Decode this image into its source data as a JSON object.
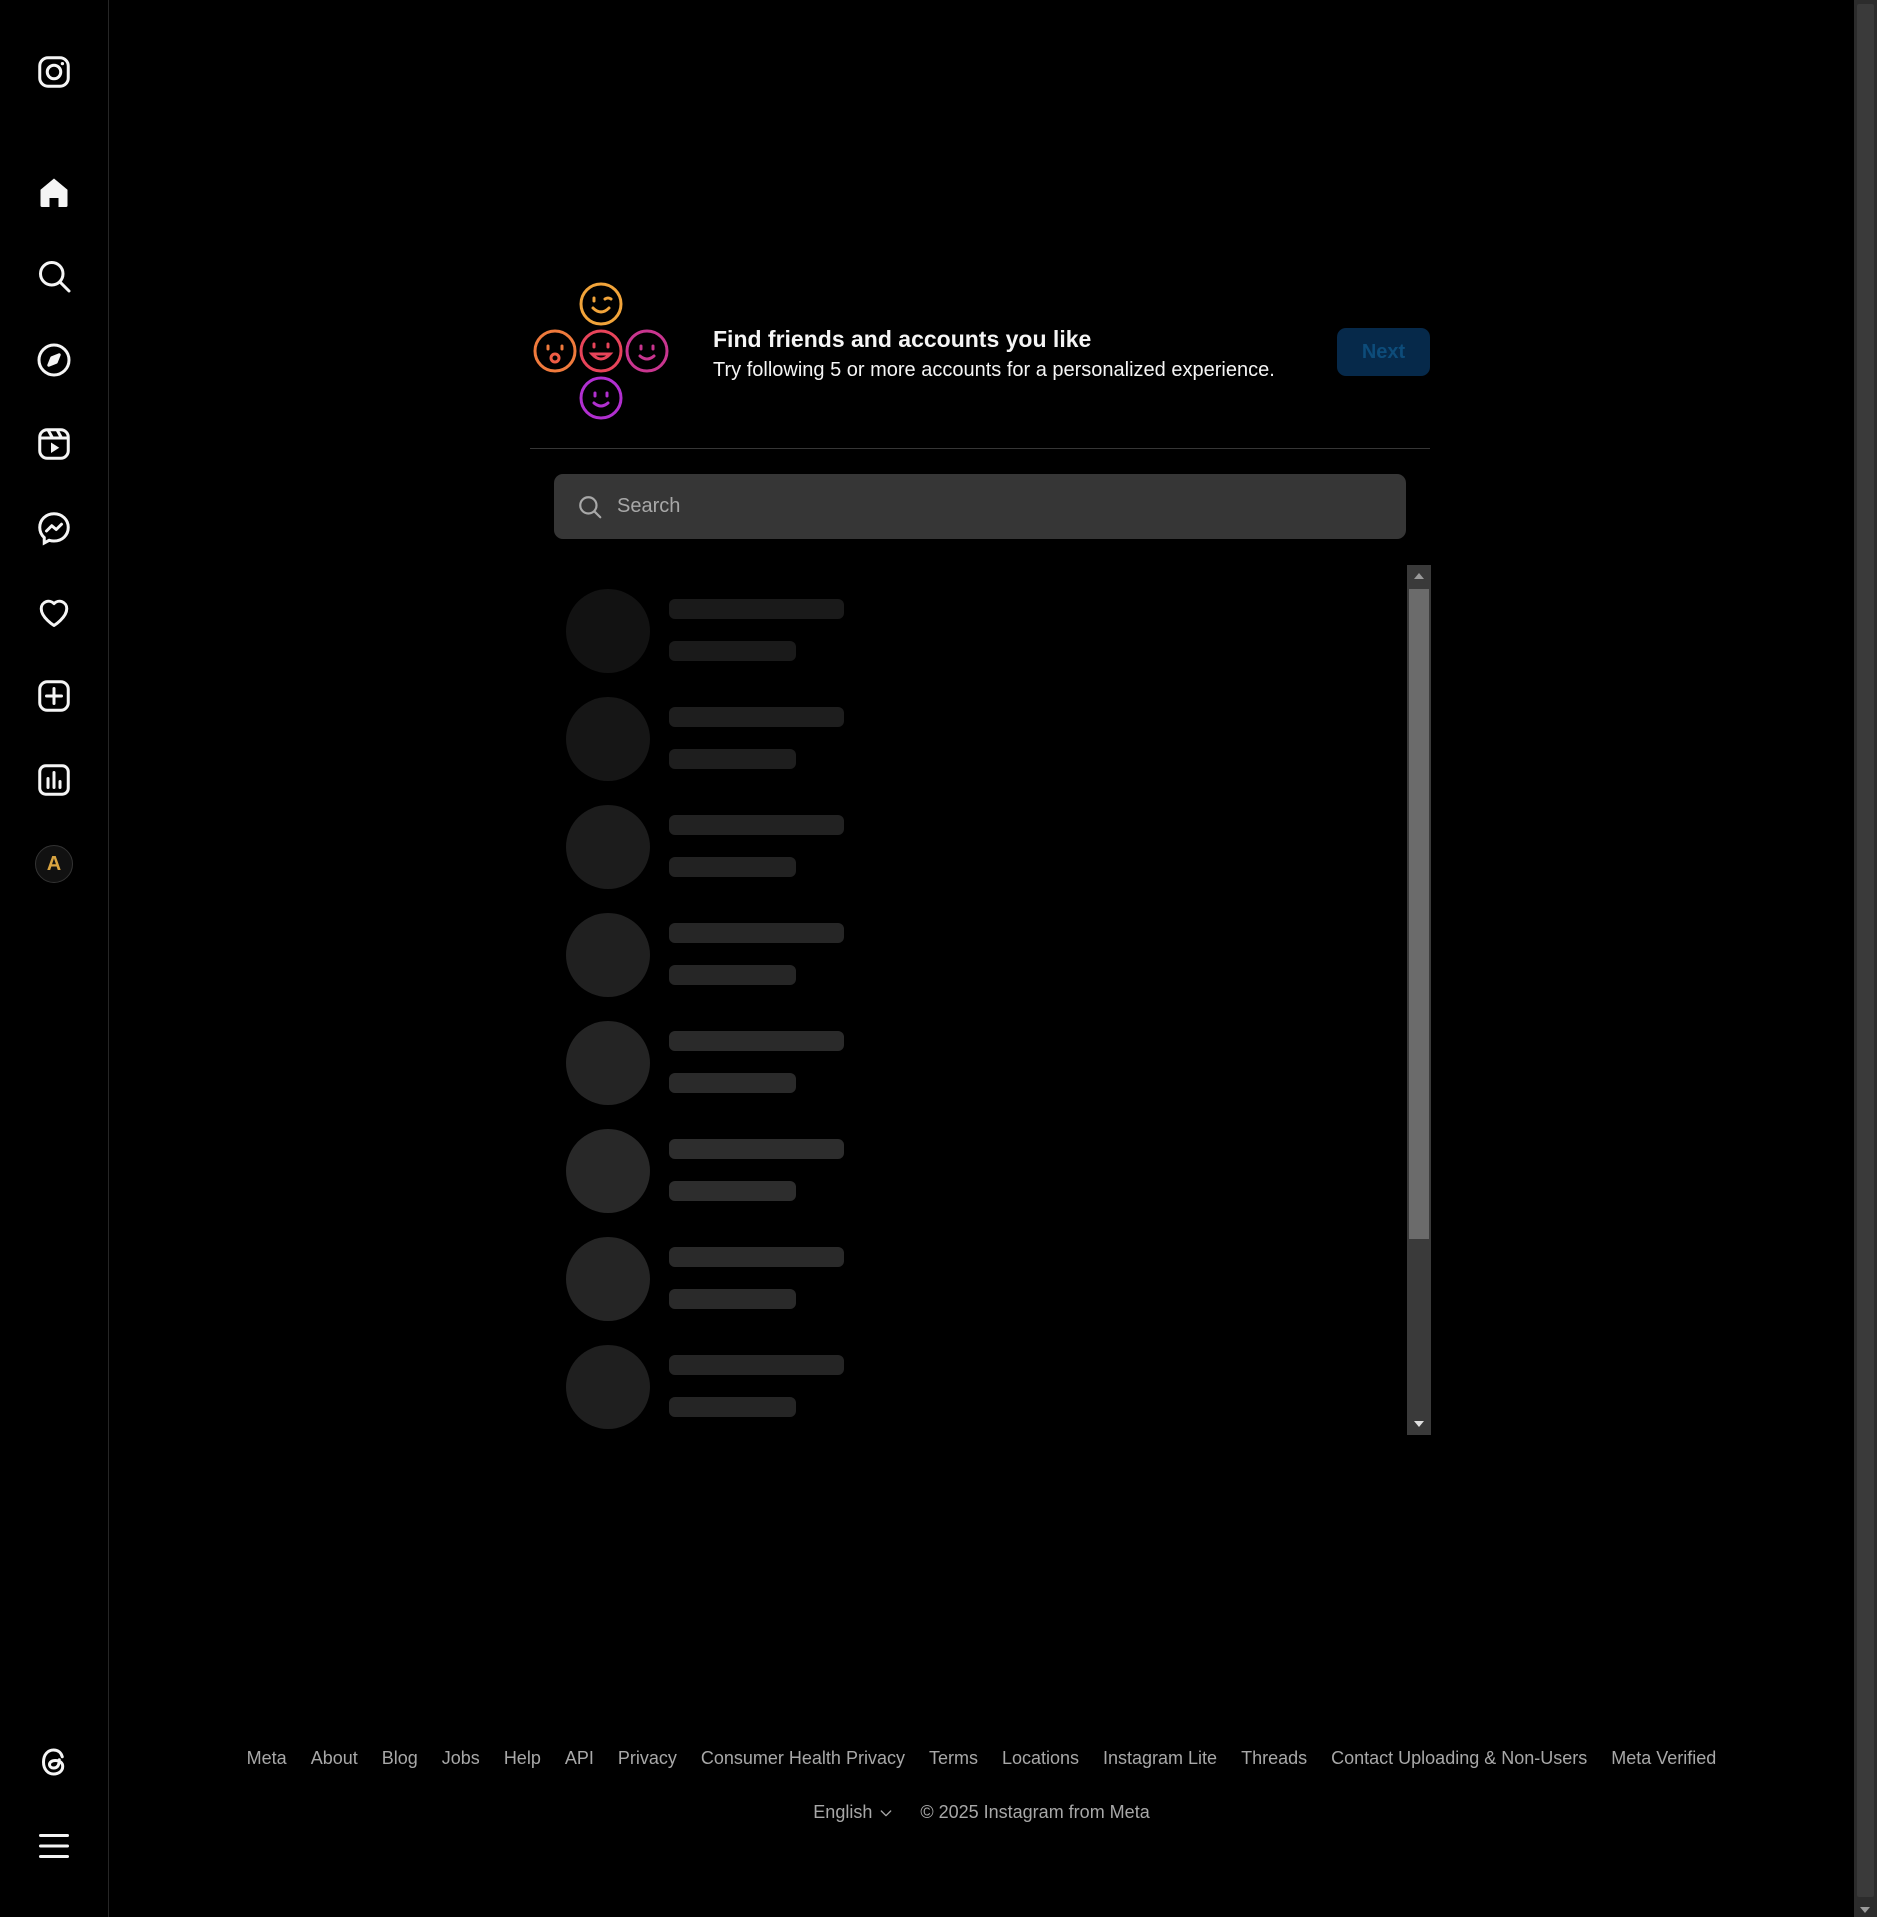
{
  "sidebar": {
    "items": [
      {
        "name": "instagram-logo-icon"
      },
      {
        "name": "home-icon"
      },
      {
        "name": "search-icon"
      },
      {
        "name": "explore-compass-icon"
      },
      {
        "name": "reels-icon"
      },
      {
        "name": "messenger-icon"
      },
      {
        "name": "heart-icon"
      },
      {
        "name": "create-plus-icon"
      },
      {
        "name": "dashboard-icon"
      },
      {
        "name": "profile-avatar",
        "initial": "A"
      },
      {
        "name": "threads-icon"
      },
      {
        "name": "menu-hamburger-icon"
      }
    ]
  },
  "header": {
    "title": "Find friends and accounts you like",
    "subtitle": "Try following 5 or more accounts for a personalized experience.",
    "next_label": "Next"
  },
  "search": {
    "placeholder": "Search"
  },
  "skeleton_rows": 8,
  "footer": {
    "links": [
      "Meta",
      "About",
      "Blog",
      "Jobs",
      "Help",
      "API",
      "Privacy",
      "Consumer Health Privacy",
      "Terms",
      "Locations",
      "Instagram Lite",
      "Threads",
      "Contact Uploading & Non-Users",
      "Meta Verified"
    ],
    "language": "English",
    "copyright": "© 2025 Instagram from Meta"
  },
  "colors": {
    "background": "#000000",
    "next_button_bg": "#06294a",
    "next_button_text": "#0d4c7a",
    "search_bg": "#363636",
    "muted_text": "#a8a8a8"
  }
}
